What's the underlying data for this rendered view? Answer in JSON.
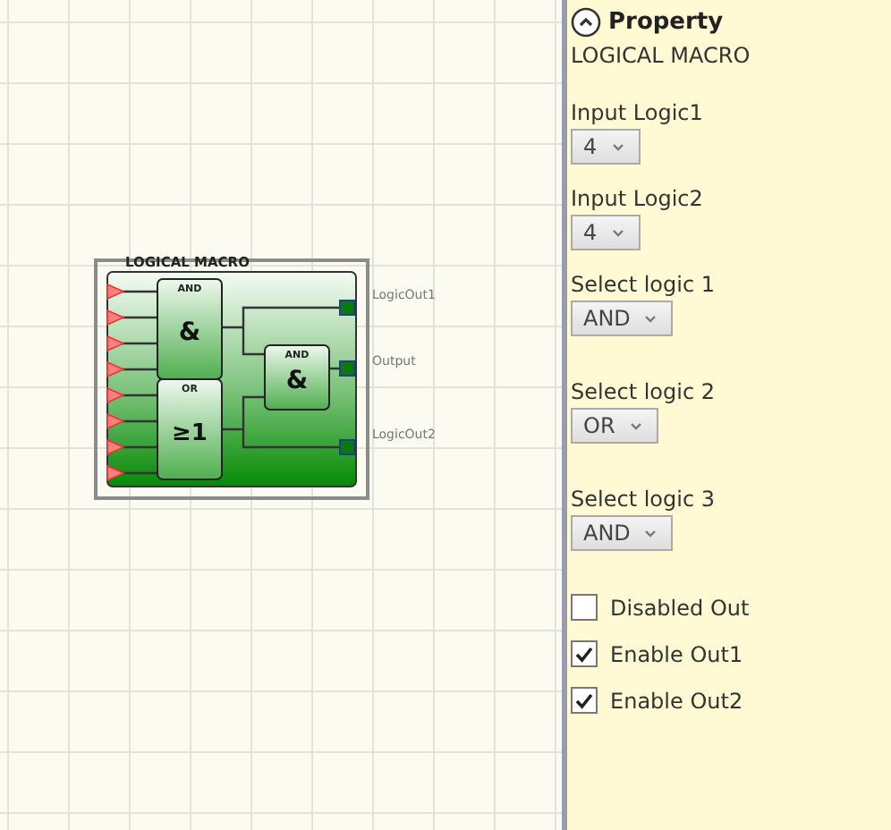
{
  "diagram": {
    "block": {
      "title": "LOGICAL MACRO",
      "gates": [
        {
          "kind": "and",
          "label": "AND",
          "symbol": "&"
        },
        {
          "kind": "or",
          "label": "OR",
          "symbol": "≥1"
        },
        {
          "kind": "and",
          "label": "AND",
          "symbol": "&"
        }
      ],
      "outputs": [
        "LogicOut1",
        "Output",
        "LogicOut2"
      ]
    }
  },
  "panel": {
    "title": "Property",
    "subtitle": "LOGICAL MACRO",
    "fields": [
      {
        "kind": "select",
        "label": "Input Logic1",
        "value": "4"
      },
      {
        "kind": "select",
        "label": "Input Logic2",
        "value": "4"
      },
      {
        "kind": "select",
        "label": "Select logic 1",
        "value": "AND"
      },
      {
        "kind": "select",
        "label": "Select logic 2",
        "value": "OR"
      },
      {
        "kind": "select",
        "label": "Select logic 3",
        "value": "AND"
      },
      {
        "kind": "checkbox",
        "label": "Disabled Out",
        "checked": false
      },
      {
        "kind": "checkbox",
        "label": "Enable Out1",
        "checked": true
      },
      {
        "kind": "checkbox",
        "label": "Enable Out2",
        "checked": true
      }
    ]
  }
}
